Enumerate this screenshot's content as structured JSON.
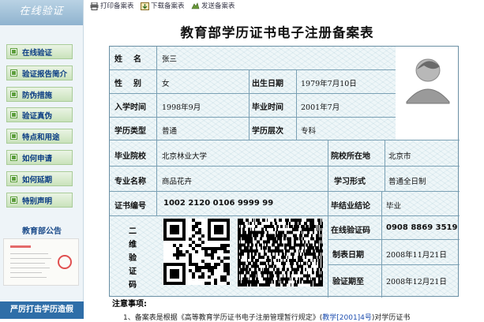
{
  "sidebar": {
    "title": "在线验证",
    "items": [
      {
        "label": "在线验证"
      },
      {
        "label": "验证报告简介"
      },
      {
        "label": "防伪措施"
      },
      {
        "label": "验证真伪"
      },
      {
        "label": "特点和用途"
      },
      {
        "label": "如何申请"
      },
      {
        "label": "如何延期"
      },
      {
        "label": "特别声明"
      }
    ],
    "notice_title": "教育部公告",
    "bottom_banner": "严厉打击学历造假"
  },
  "toolbar": {
    "print": "打印备案表",
    "download": "下载备案表",
    "send": "发送备案表"
  },
  "document": {
    "title": "教育部学历证书电子注册备案表",
    "fields": {
      "name_label": "姓名",
      "name_value": "张三",
      "gender_label": "性别",
      "gender_value": "女",
      "birth_label": "出生日期",
      "birth_value": "1979年7月10日",
      "enroll_label": "入学时间",
      "enroll_value": "1998年9月",
      "grad_label": "毕业时间",
      "grad_value": "2001年7月",
      "type_label": "学历类型",
      "type_value": "普通",
      "level_label": "学历层次",
      "level_value": "专科",
      "school_label": "毕业院校",
      "school_value": "北京林业大学",
      "location_label": "院校所在地",
      "location_value": "北京市",
      "major_label": "专业名称",
      "major_value": "商品花卉",
      "form_label": "学习形式",
      "form_value": "普通全日制",
      "cert_label": "证书编号",
      "cert_value": "1002 2120 0106 9999 99",
      "conclusion_label": "毕结业结论",
      "conclusion_value": "毕业",
      "qr_label": "二维验证码",
      "verify_label": "在线验证码",
      "verify_value": "0908 8869 3519",
      "made_label": "制表日期",
      "made_value": "2008年11月21日",
      "expire_label": "验证期至",
      "expire_value": "2008年12月21日"
    },
    "notes_title": "注意事项:",
    "note1_prefix": "1、备案表是根据《高等教育学历证书电子注册管理暂行规定》(",
    "note1_link": "教学[2001]4号",
    "note1_suffix": ")对学历证书"
  },
  "colors": {
    "border": "#6a8fa4",
    "nav_text": "#0b3d84",
    "link": "#1f4fb0"
  }
}
